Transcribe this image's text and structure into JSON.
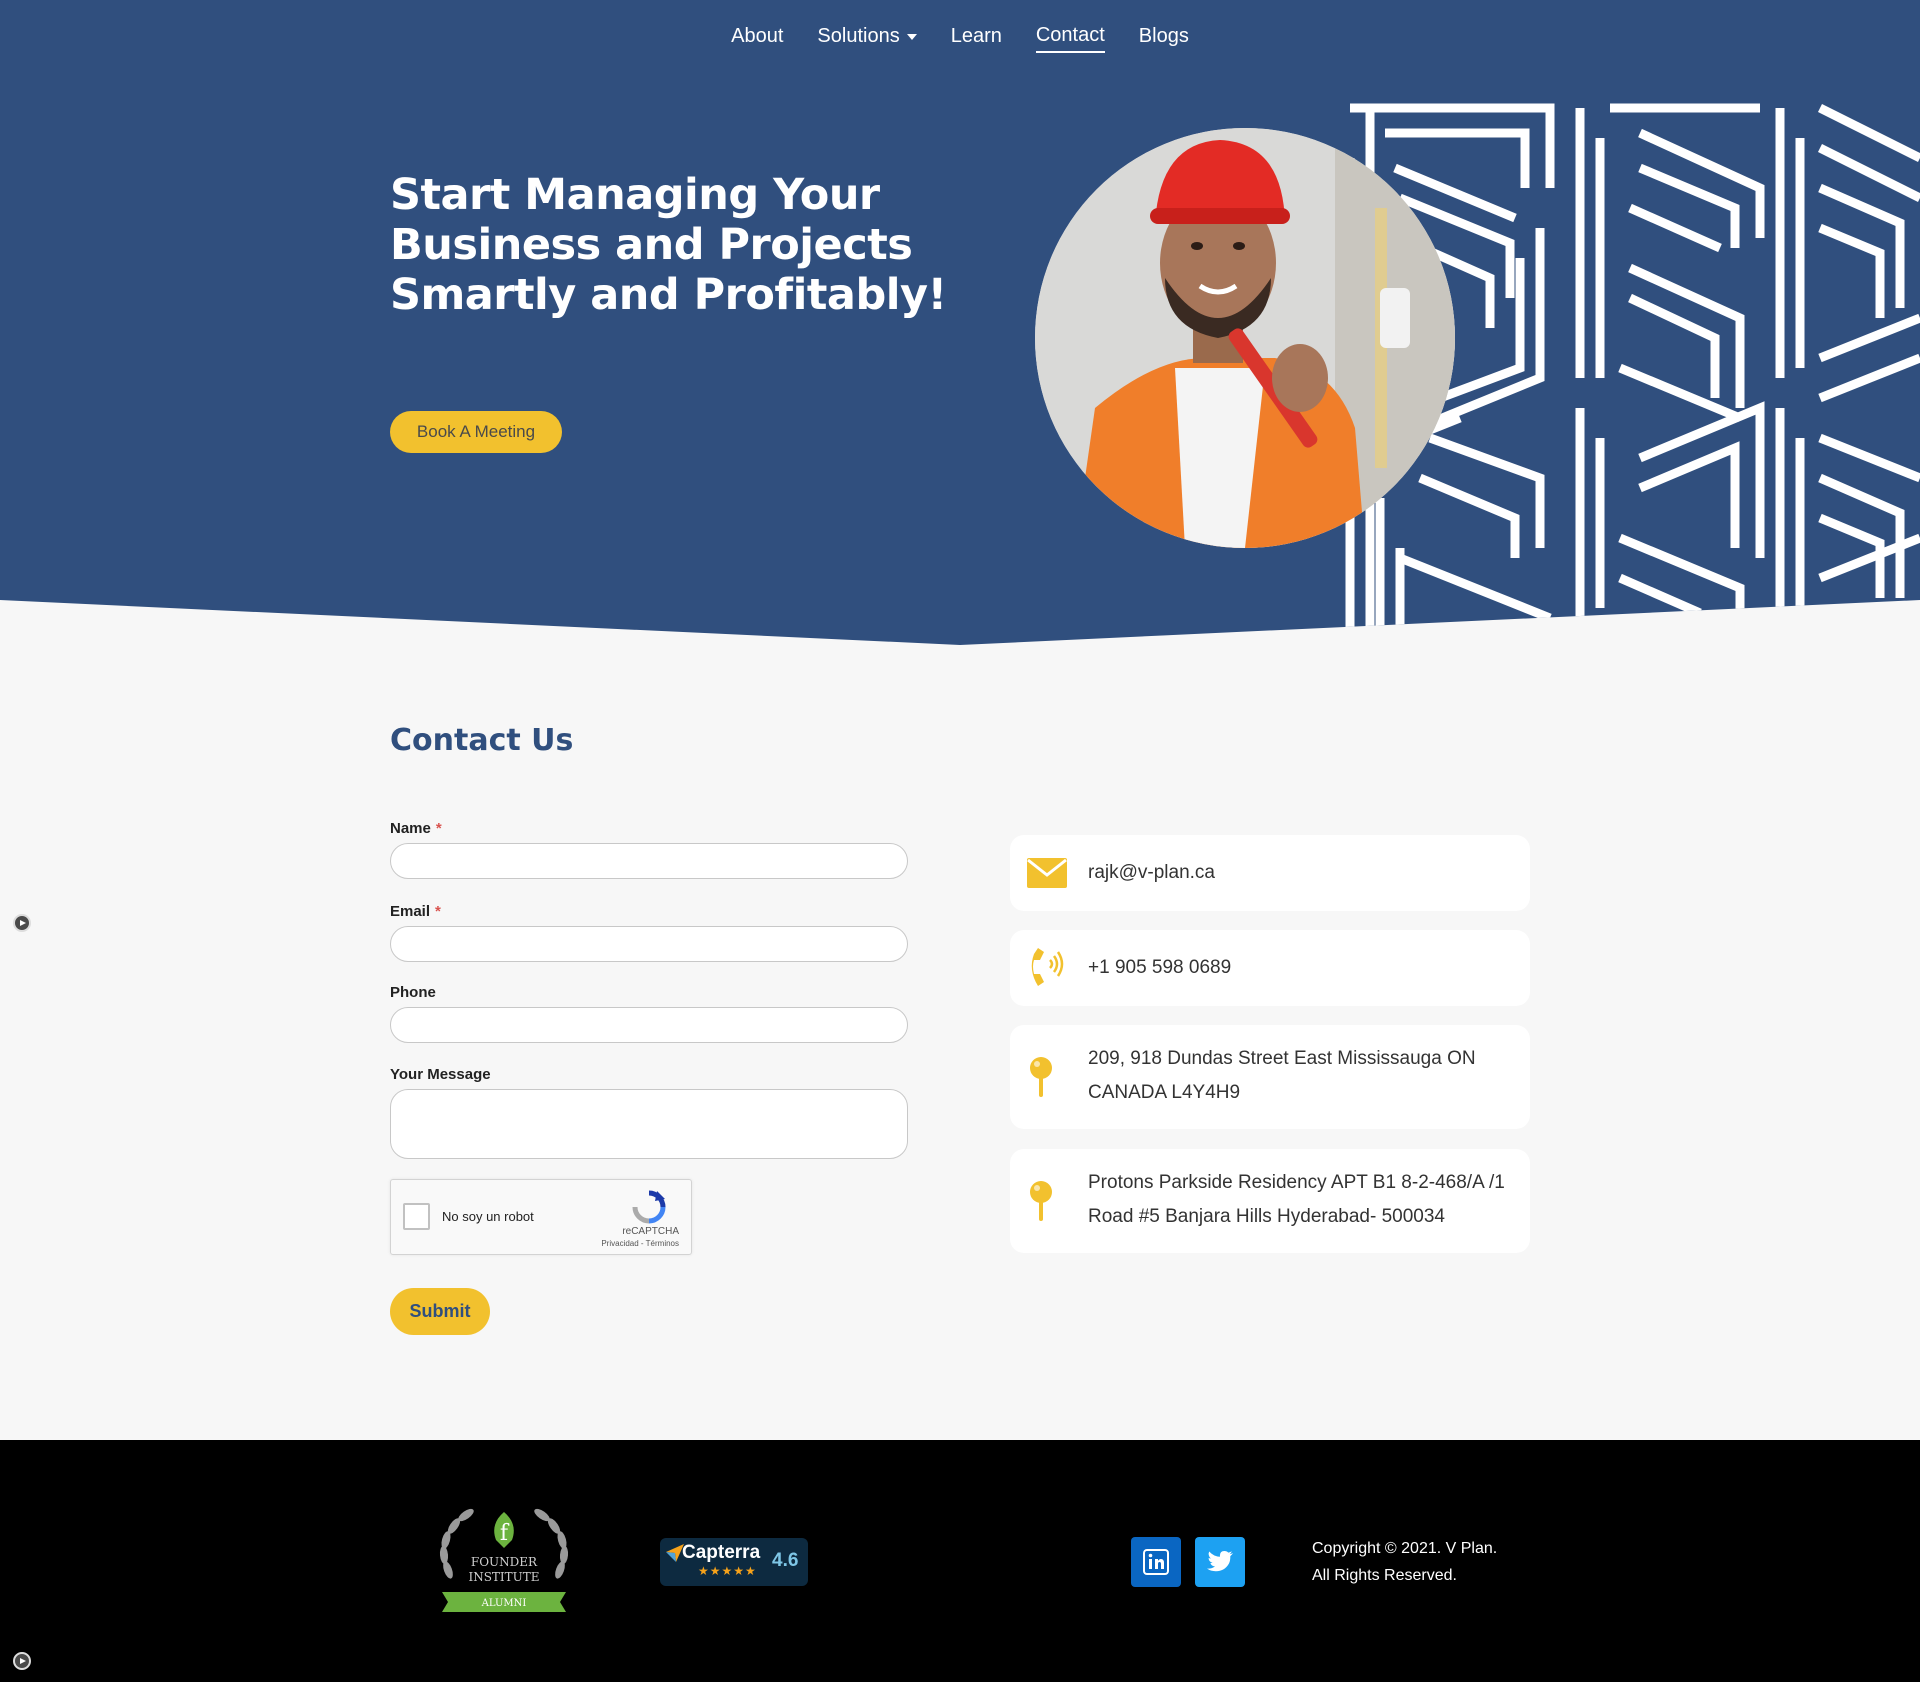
{
  "nav": {
    "items": [
      {
        "label": "About",
        "active": false
      },
      {
        "label": "Solutions",
        "active": false,
        "has_dropdown": true
      },
      {
        "label": "Learn",
        "active": false
      },
      {
        "label": "Contact",
        "active": true
      },
      {
        "label": "Blogs",
        "active": false
      }
    ]
  },
  "hero": {
    "title": "Start Managing Your Business and Projects Smartly and Profitably!",
    "cta_label": "Book A Meeting"
  },
  "contact": {
    "title": "Contact Us",
    "fields": {
      "name_label": "Name",
      "email_label": "Email",
      "phone_label": "Phone",
      "message_label": "Your Message",
      "required_mark": "*",
      "name_value": "",
      "email_value": "",
      "phone_value": "",
      "message_value": ""
    },
    "recaptcha": {
      "label": "No soy un robot",
      "brand": "reCAPTCHA",
      "terms": "Privacidad - Términos"
    },
    "submit_label": "Submit"
  },
  "info": {
    "email": "rajk@v-plan.ca",
    "phone": "+1 905 598 0689",
    "address1": "209, 918 Dundas Street East Mississauga ON CANADA L4Y4H9",
    "address2": "Protons Parkside Residency APT B1 8-2-468/A /1 Road #5 Banjara Hills Hyderabad- 500034"
  },
  "footer": {
    "founder_badge": {
      "line1": "FOUNDER",
      "line2": "INSTITUTE",
      "ribbon": "ALUMNI"
    },
    "capterra": {
      "name": "Capterra",
      "score": "4.6",
      "stars": "★★★★★"
    },
    "social": [
      {
        "name": "linkedin-icon",
        "color": "#0a66c2"
      },
      {
        "name": "twitter-icon",
        "color": "#1da1f2"
      }
    ],
    "copyright_line1": "Copyright © 2021. V Plan.",
    "copyright_line2": "All Rights Reserved."
  },
  "colors": {
    "brand_blue": "#304f7e",
    "accent_yellow": "#f2c12e",
    "footer_bg": "#000000",
    "page_bg": "#f7f7f7"
  }
}
